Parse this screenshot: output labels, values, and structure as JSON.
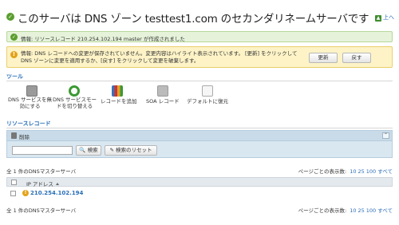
{
  "header": {
    "title": "このサーバは DNS ゾーン testtest1.com のセカンダリネームサーバです",
    "up_label": "上へ"
  },
  "banner_success": {
    "text": "情報: リソースレコード 210.254.102.194 master が作成されました"
  },
  "banner_warning": {
    "text": "情報: DNS レコードへの変更が保存されていません。変更内容はハイライト表示されています。 [更新] をクリックして DNS ゾーンに変更を適用するか、[戻す] をクリックして変更を破棄します。",
    "update_button": "更新",
    "undo_button": "戻す"
  },
  "tools": {
    "heading": "ツール",
    "items": [
      {
        "label_line1": "DNS サービスを無",
        "label_line2": "効にする",
        "icon": "dns-disable-icon"
      },
      {
        "label_line1": "DNS サービスモー",
        "label_line2": "ドを切り替える",
        "icon": "switch-mode-icon"
      },
      {
        "label_line1": "レコードを追加",
        "label_line2": "",
        "icon": "add-record-icon"
      },
      {
        "label_line1": "SOA レコード",
        "label_line2": "",
        "icon": "soa-record-icon"
      },
      {
        "label_line1": "デフォルトに復元",
        "label_line2": "",
        "icon": "restore-default-icon"
      }
    ]
  },
  "records": {
    "heading": "リソースレコード",
    "delete_label": "削除",
    "search_value": "",
    "search_button": "検索",
    "reset_button": "検索のリセット",
    "count_text": "全 1 件のDNSマスターサーバ",
    "per_page_label": "ページごとの表示数:",
    "per_page_options": [
      "10",
      "25",
      "100",
      "すべて"
    ],
    "column_header": "IP アドレス",
    "rows": [
      {
        "ip": "210.254.102.194"
      }
    ]
  }
}
